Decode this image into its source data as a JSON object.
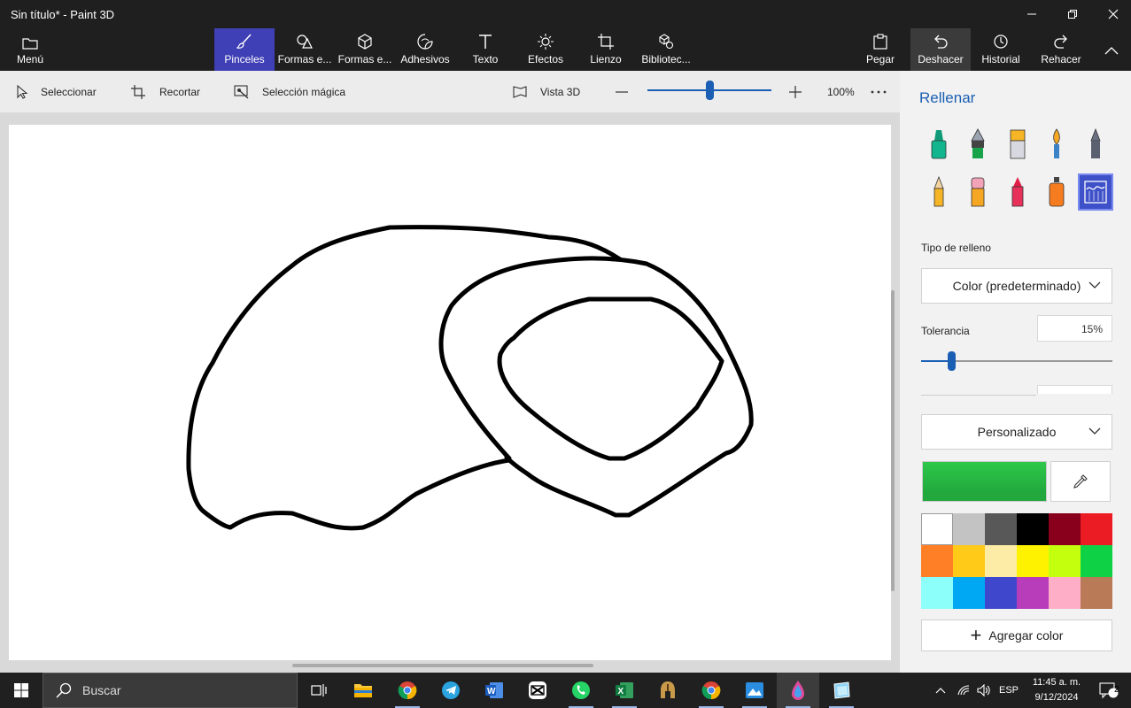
{
  "window": {
    "title": "Sin título* - Paint 3D"
  },
  "ribbon": {
    "menu": "Menú",
    "brushes": "Pinceles",
    "shapes2d": "Formas e...",
    "shapes3d": "Formas e...",
    "stickers": "Adhesivos",
    "text": "Texto",
    "effects": "Efectos",
    "canvas": "Lienzo",
    "library": "Bibliotec...",
    "paste": "Pegar",
    "undo": "Deshacer",
    "history": "Historial",
    "redo": "Rehacer"
  },
  "toolbar": {
    "select": "Seleccionar",
    "crop": "Recortar",
    "magic_select": "Selección mágica",
    "view3d": "Vista 3D",
    "zoom": "100%",
    "zoom_fraction": 0.5
  },
  "panel": {
    "title": "Rellenar",
    "fill_type_label": "Tipo de relleno",
    "fill_type_value": "Color (predeterminado)",
    "tolerance_label": "Tolerancia",
    "tolerance_value": "15%",
    "tolerance_fraction": 0.15,
    "color_mode": "Personalizado",
    "current_color": "#2ec84a",
    "add_color": "Agregar color",
    "swatches": [
      "#ffffff",
      "#c3c3c3",
      "#585858",
      "#000000",
      "#88001b",
      "#ec1c24",
      "#ff7f27",
      "#ffca18",
      "#fdeca6",
      "#fff200",
      "#c4ff0e",
      "#0ed145",
      "#8cfffb",
      "#00a8f3",
      "#3f48cc",
      "#b83dba",
      "#ffaec8",
      "#b97a57"
    ]
  },
  "taskbar": {
    "search": "Buscar",
    "lang": "ESP",
    "time": "11:45 a. m.",
    "date": "9/12/2024",
    "notifications": "2"
  }
}
